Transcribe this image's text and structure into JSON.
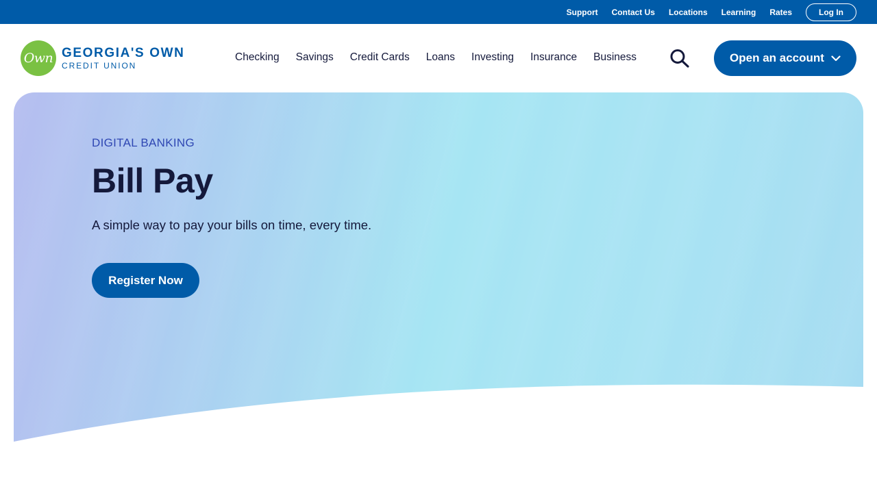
{
  "utility_nav": {
    "links": [
      "Support",
      "Contact Us",
      "Locations",
      "Learning",
      "Rates"
    ],
    "login_label": "Log In"
  },
  "brand": {
    "logo_mark": "Own",
    "name_line1": "GEORGIA'S OWN",
    "name_line2": "CREDIT UNION"
  },
  "main_nav": {
    "items": [
      "Checking",
      "Savings",
      "Credit Cards",
      "Loans",
      "Investing",
      "Insurance",
      "Business"
    ],
    "search_icon": "search-icon",
    "open_account_label": "Open an account",
    "open_account_icon": "chevron-down-icon"
  },
  "hero": {
    "eyebrow": "DIGITAL BANKING",
    "title": "Bill Pay",
    "subtitle": "A simple way to pay your bills on time, every time.",
    "cta_label": "Register Now"
  },
  "colors": {
    "brand_blue": "#005ba8",
    "brand_green": "#7ac143",
    "text_dark": "#14193b",
    "eyebrow_blue": "#2f47b3"
  }
}
